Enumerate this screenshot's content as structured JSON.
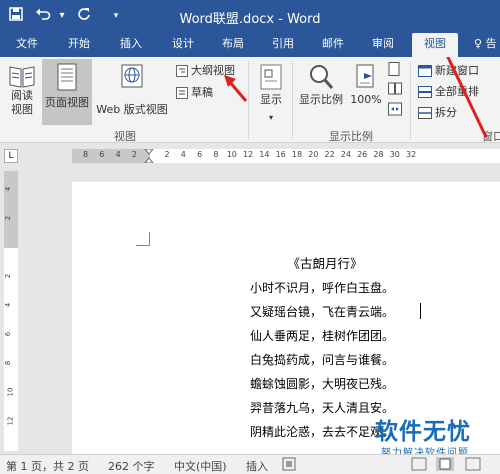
{
  "window": {
    "title": "Word联盟.docx - Word",
    "quick_access": [
      "save-icon",
      "undo-icon",
      "redo-icon",
      "customize-icon"
    ]
  },
  "tabs": [
    {
      "label": "文件"
    },
    {
      "label": "开始"
    },
    {
      "label": "插入"
    },
    {
      "label": "设计"
    },
    {
      "label": "布局"
    },
    {
      "label": "引用"
    },
    {
      "label": "邮件"
    },
    {
      "label": "审阅"
    },
    {
      "label": "视图",
      "active": true
    }
  ],
  "tell_me": "告",
  "ribbon": {
    "views_group": {
      "read_mode": "阅读\n视图",
      "read_mode_l1": "阅读",
      "read_mode_l2": "视图",
      "print_layout": "页面视图",
      "web_layout": "Web 版式视图",
      "outline": "大纲视图",
      "draft": "草稿",
      "group_label": "视图"
    },
    "show": "显示",
    "zoom_group": {
      "zoom": "显示比例",
      "zoom_100": "100%",
      "group_label": "显示比例"
    },
    "window_group": {
      "new_window": "新建窗口",
      "arrange_all": "全部重排",
      "split": "拆分",
      "group_label": "窗口"
    },
    "accent_color": "#2b579a",
    "arrow_color": "#e02020"
  },
  "ruler": {
    "tabstop": "L",
    "horizontal_ticks": [
      "8",
      "6",
      "4",
      "2",
      "",
      "2",
      "4",
      "6",
      "8",
      "10",
      "12",
      "14",
      "16",
      "18",
      "20",
      "22",
      "24",
      "26",
      "28",
      "30",
      "32"
    ],
    "vertical_ticks": [
      "4",
      "2",
      "",
      "2",
      "4",
      "6",
      "8",
      "10",
      "12"
    ]
  },
  "document": {
    "title": "《古朗月行》",
    "lines": [
      "小时不识月，呼作白玉盘。",
      "又疑瑶台镜，飞在青云端。",
      "仙人垂两足，桂树作团团。",
      "白兔捣药成，问言与谁餐。",
      "蟾蜍蚀圆影，大明夜已残。",
      "羿昔落九乌，天人清且安。",
      "阴精此沦惑，去去不足观。"
    ]
  },
  "watermark": {
    "text": "软件无忧",
    "sub": "努力解决软件问题"
  },
  "status": {
    "page": "第 1 页，共 2 页",
    "words": "262 个字",
    "language": "中文(中国)",
    "mode": "插入"
  }
}
